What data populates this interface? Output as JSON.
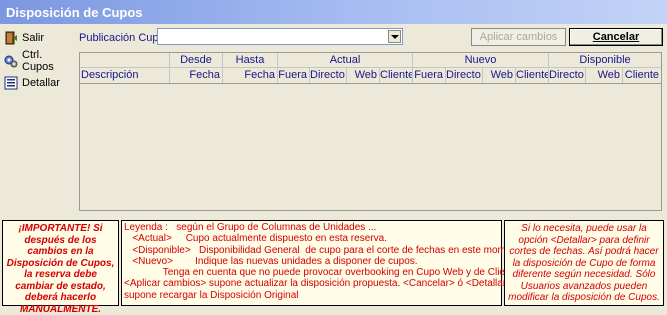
{
  "window": {
    "title": "Disposición de Cupos"
  },
  "sidebar": {
    "exit_label": "Salir",
    "ctrl_label": "Ctrl. Cupos",
    "detail_label": "Detallar"
  },
  "toolbar": {
    "publication_label": "Publicación Cupo",
    "publication_value": "",
    "apply_label": "Aplicar cambios",
    "cancel_label": "Cancelar"
  },
  "grid": {
    "groups": [
      "Desde",
      "Hasta",
      "Actual",
      "Nuevo",
      "Disponible"
    ],
    "columns": [
      "Descripción",
      "Fecha",
      "Fecha",
      "Fuera",
      "Directo",
      "Web",
      "Cliente",
      "Fuera",
      "Directo",
      "Web",
      "Cliente",
      "Directo",
      "Web",
      "Cliente"
    ]
  },
  "notes": {
    "important": "¡IMPORTANTE! Si después de los cambios en la Disposición de Cupos, la reserva debe cambiar de estado, deberá hacerlo MANUALMENTE.",
    "legend_lines": [
      "Leyenda :   según el Grupo de Columnas de Unidades ...",
      "   <Actual>     Cupo actualmente dispuesto en esta reserva.",
      "   <Disponible>   Disponibilidad General  de cupo para el corte de fechas en este momento.",
      "   <Nuevo>        Indique las nuevas unidades a disponer de cupos.",
      "              Tenga en cuenta que no puede provocar overbooking en Cupo Web y de Cliente.",
      "<Aplicar cambios> supone actualizar la disposición propuesta. <Cancelar> ó <Detallar>",
      "supone recargar la Disposición Original"
    ],
    "help": "Si lo necesita, puede usar la opción <Detallar> para definir cortes de fechas. Así podrá hacer la disposición de Cupo de forma diferente según necesidad. Sólo Usuarios avanzados pueden modificar la disposición de Cupos."
  }
}
